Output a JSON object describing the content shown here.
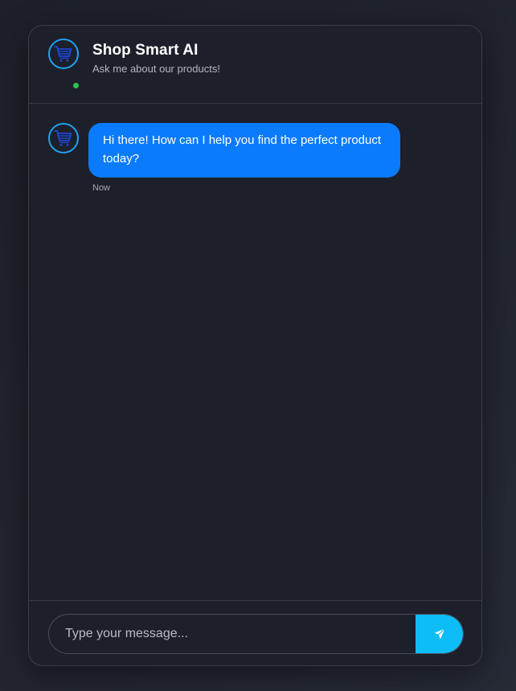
{
  "header": {
    "title": "Shop Smart AI",
    "subtitle": "Ask me about our products!",
    "avatar_icon": "shopping-cart-icon",
    "status": "online",
    "status_color": "#2fbf4f"
  },
  "messages": [
    {
      "sender": "bot",
      "avatar_icon": "shopping-cart-icon",
      "text": "Hi there! How can I help you find the perfect product today?",
      "time": "Now"
    }
  ],
  "composer": {
    "placeholder": "Type your message...",
    "value": "",
    "send_icon": "send-arrow-icon"
  },
  "colors": {
    "accent": "#1ea3f1",
    "bubble": "#0a7bfd",
    "send_button": "#0cbdf6",
    "panel_bg": "#1d1f2a"
  }
}
